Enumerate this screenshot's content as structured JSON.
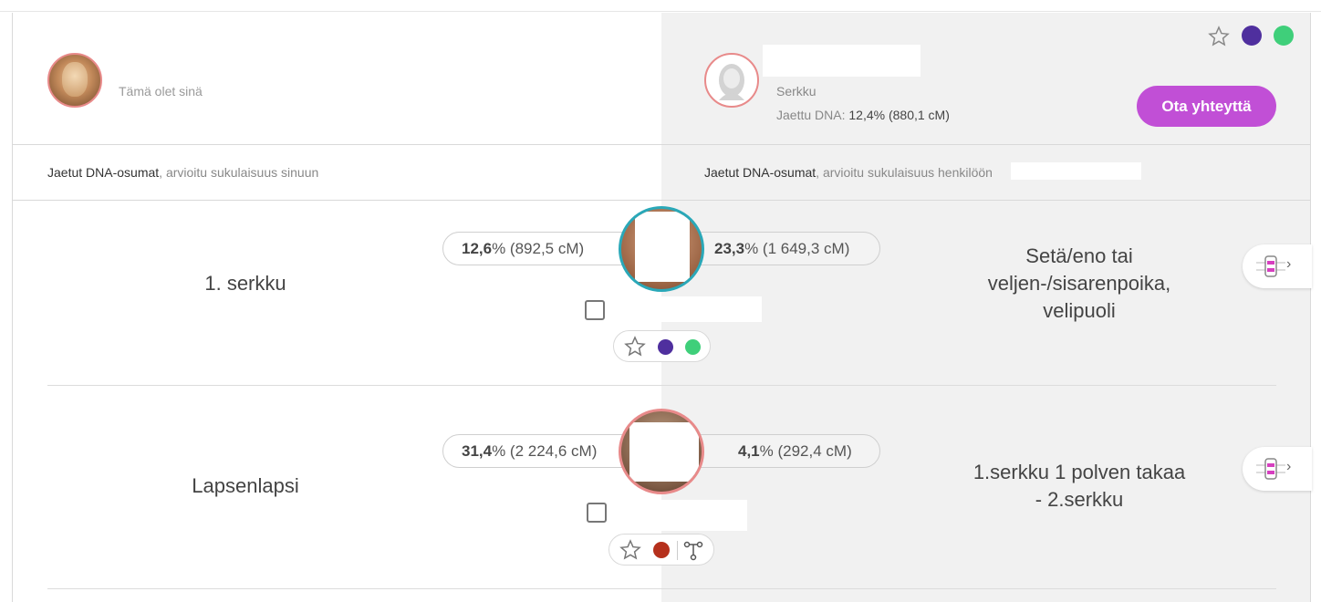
{
  "header": {
    "me": {
      "subtitle": "Tämä olet sinä"
    },
    "match": {
      "relationship": "Serkku",
      "dna_label": "Jaettu DNA:",
      "dna_value": "12,4% (880,1 cM)",
      "contact_button": "Ota yhteyttä"
    },
    "tag_colors": [
      "#4f2f9e",
      "#3fcf7a"
    ]
  },
  "subheaders": {
    "left_bold": "Jaetut DNA-osumat",
    "left_muted": ", arvioitu sukulaisuus sinuun",
    "right_bold": "Jaetut DNA-osumat",
    "right_muted": ", arvioitu sukulaisuus henkilöön"
  },
  "rows": [
    {
      "left_relationship": "1. serkku",
      "left_percent": "12,6",
      "left_cm": "% (892,5 cM)",
      "right_percent": "23,3",
      "right_cm": "% (1 649,3 cM)",
      "right_relationship_lines": [
        "Setä/eno tai",
        "veljen-/sisarenpoika,",
        "velipuoli"
      ],
      "tags": [
        "#4f2f9e",
        "#3fcf7a"
      ]
    },
    {
      "left_relationship": "Lapsenlapsi",
      "left_percent": "31,4",
      "left_cm": "% (2 224,6 cM)",
      "right_percent": "4,1",
      "right_cm": "% (292,4 cM)",
      "right_relationship_lines": [
        "1.serkku 1 polven takaa",
        "- 2.serkku"
      ],
      "tags": [
        "#b5301c"
      ]
    }
  ]
}
